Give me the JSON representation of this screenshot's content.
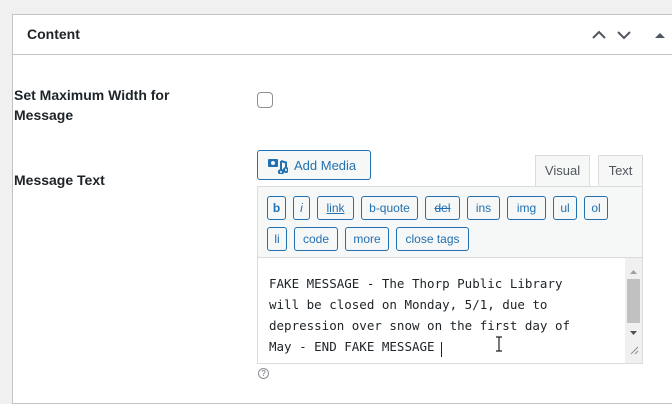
{
  "panel": {
    "title": "Content",
    "controls": [
      "chevron-up-icon",
      "chevron-down-icon",
      "arrow-up-icon"
    ]
  },
  "fields": {
    "max_width": {
      "label_line1": "Set Maximum Width for",
      "label_line2": "Message",
      "checked": false
    },
    "message_text": {
      "label": "Message Text"
    }
  },
  "editor": {
    "add_media_label": "Add Media",
    "tabs": [
      {
        "label": "Visual",
        "active": false
      },
      {
        "label": "Text",
        "active": true
      }
    ],
    "quicktags": [
      "b",
      "i",
      "link",
      "b-quote",
      "del",
      "ins",
      "img",
      "ul",
      "ol",
      "li",
      "code",
      "more",
      "close tags"
    ],
    "content": "FAKE MESSAGE - The Thorp Public Library\nwill be closed on Monday, 5/1, due to\ndepression over snow on the first day of\nMay - END FAKE MESSAGE"
  },
  "colors": {
    "accent": "#2271b1",
    "border": "#c3c4c7",
    "background": "#f0f0f1"
  }
}
